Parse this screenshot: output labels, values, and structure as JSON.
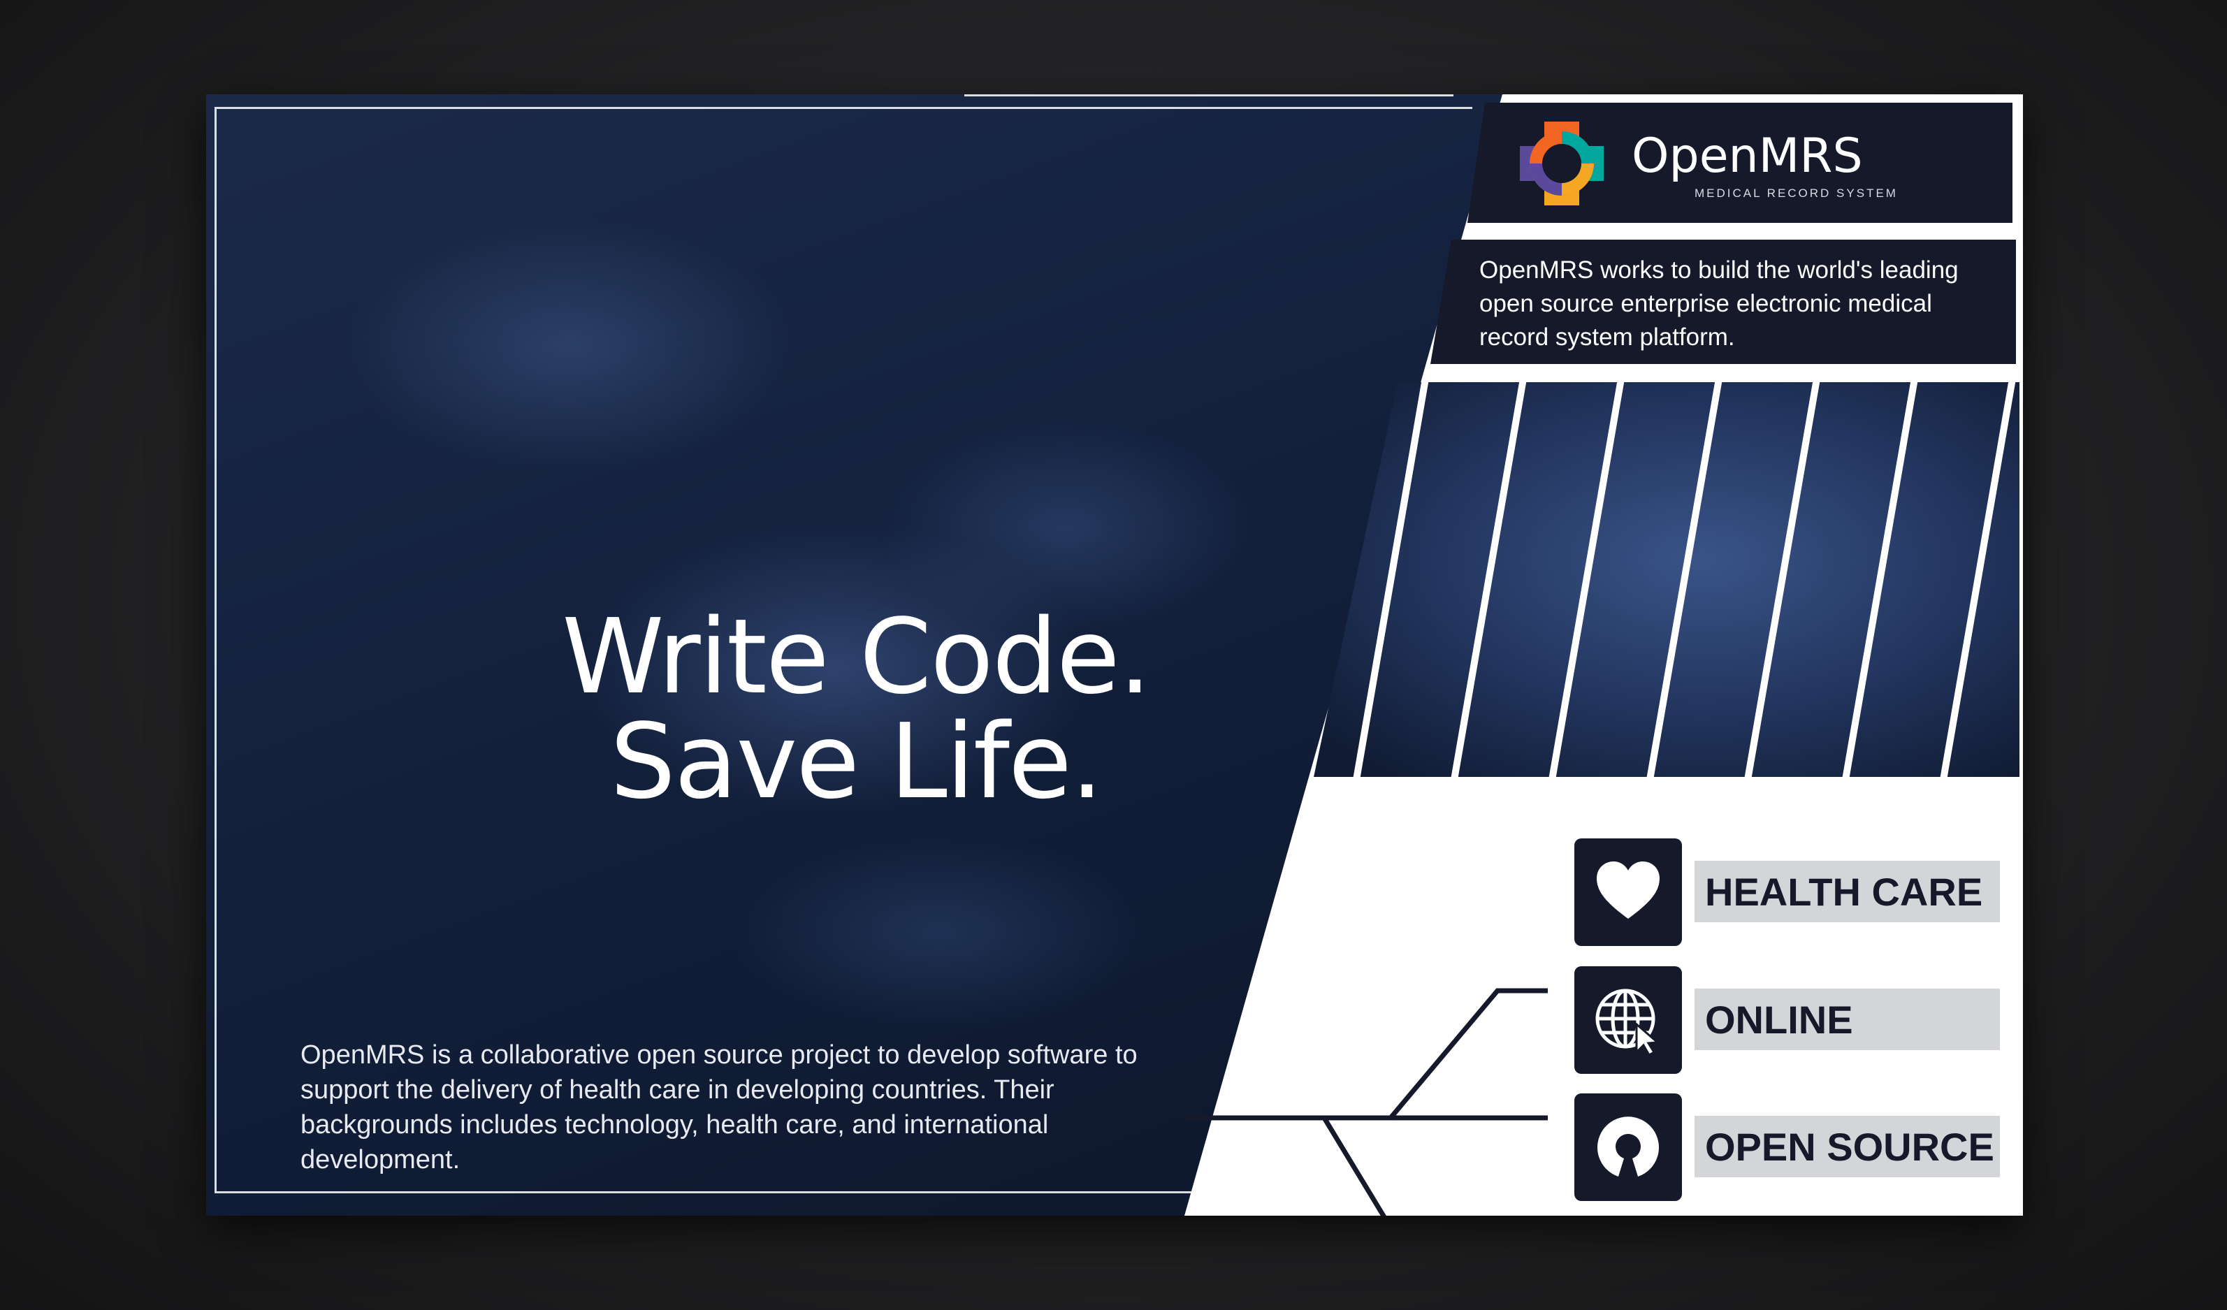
{
  "headline": {
    "line1": "Write Code.",
    "line2": "Save Life."
  },
  "body_text": "OpenMRS is a collaborative open source project to develop software to support the delivery of health care in developing countries. Their backgrounds includes technology, health care, and international development.",
  "logo": {
    "name": "OpenMRS",
    "tagline": "MEDICAL RECORD SYSTEM"
  },
  "description": "OpenMRS works to build the world's leading open source enterprise electronic medical record system platform.",
  "features": [
    {
      "icon": "heart-icon",
      "label": "HEALTH CARE"
    },
    {
      "icon": "globe-cursor-icon",
      "label": "ONLINE"
    },
    {
      "icon": "open-source-icon",
      "label": "OPEN SOURCE"
    }
  ],
  "colors": {
    "navy": "#15192a",
    "photo_blue": "#13213d",
    "label_gray": "#d4d5d8",
    "logo_orange": "#f26522",
    "logo_purple": "#5b4a9b",
    "logo_green": "#00a79d",
    "logo_yellow": "#f5a623"
  }
}
